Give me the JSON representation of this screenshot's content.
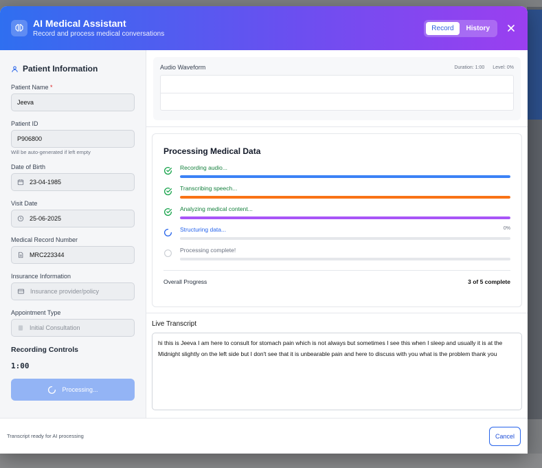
{
  "header": {
    "title": "AI Medical Assistant",
    "subtitle": "Record and process medical conversations",
    "tabs": [
      {
        "label": "Record",
        "active": true
      },
      {
        "label": "History",
        "active": false
      }
    ]
  },
  "patient": {
    "section_title": "Patient Information",
    "name_label": "Patient Name",
    "required_mark": "*",
    "name_value": "Jeeva",
    "id_label": "Patient ID",
    "id_value": "P906800",
    "id_hint": "Will be auto-generated if left empty",
    "dob_label": "Date of Birth",
    "dob_value": "23-04-1985",
    "visit_label": "Visit Date",
    "visit_value": "25-06-2025",
    "mrn_label": "Medical Record Number",
    "mrn_value": "MRC223344",
    "insurance_label": "Insurance Information",
    "insurance_placeholder": "Insurance provider/policy",
    "appointment_label": "Appointment Type",
    "appointment_value": "Initial Consultation"
  },
  "recording": {
    "title": "Recording Controls",
    "timer": "1:00",
    "button_label": "Processing..."
  },
  "waveform": {
    "title": "Audio Waveform",
    "duration": "Duration: 1:00",
    "level": "Level: 0%"
  },
  "processing": {
    "title": "Processing Medical Data",
    "steps": [
      {
        "label": "Recording audio...",
        "status": "done",
        "progress": 1.0,
        "color": "#3b82f6",
        "text_color": "#15803d"
      },
      {
        "label": "Transcribing speech...",
        "status": "done",
        "progress": 1.0,
        "color": "#f97316",
        "text_color": "#15803d"
      },
      {
        "label": "Analyzing medical content...",
        "status": "done",
        "progress": 1.0,
        "color": "#a855f7",
        "text_color": "#15803d"
      },
      {
        "label": "Structuring data...",
        "status": "active",
        "progress": 0.0,
        "percent": "0%",
        "color": "#3b82f6",
        "text_color": "#2563eb"
      },
      {
        "label": "Processing complete!",
        "status": "pending",
        "progress": 0.0,
        "color": "#9ca3af",
        "text_color": "#6b7280"
      }
    ],
    "overall_label": "Overall Progress",
    "overall_value": "3 of 5 complete"
  },
  "transcript": {
    "title": "Live Transcript",
    "text": "hi this is Jeeva  I am here to consult for stomach pain  which is not always but sometimes I see this when I  sleep and usually it is at the Midnight  slightly on the left side  but I don't  see that it is unbearable pain  and here to discuss with you what is the problem  thank you"
  },
  "footer": {
    "status": "Transcript ready for AI processing",
    "cancel_label": "Cancel"
  },
  "colors": {
    "header_start": "#2f6ff0",
    "header_end": "#9b3ff0",
    "done_green": "#16a34a",
    "accent_blue": "#2563eb"
  }
}
